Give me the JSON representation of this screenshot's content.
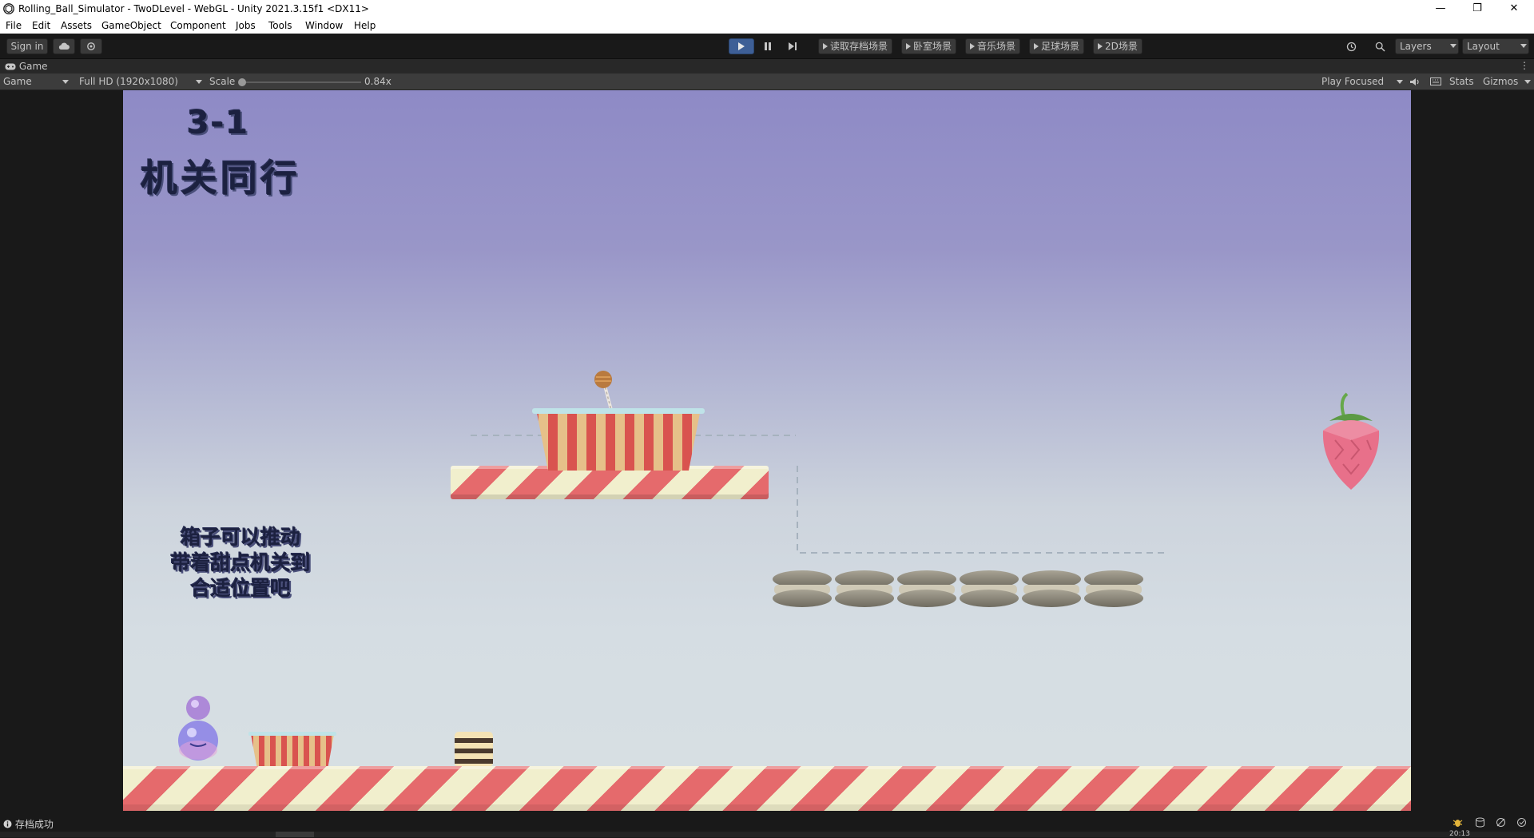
{
  "window": {
    "title": "Rolling_Ball_Simulator - TwoDLevel - WebGL - Unity 2021.3.15f1 <DX11>",
    "minimize": "—",
    "maximize": "❐",
    "close": "✕"
  },
  "menu": [
    "File",
    "Edit",
    "Assets",
    "GameObject",
    "Component",
    "Jobs",
    "Tools",
    "Window",
    "Help"
  ],
  "toolbar": {
    "sign_in": "Sign in",
    "scene_buttons": [
      "读取存档场景",
      "卧室场景",
      "音乐场景",
      "足球场景",
      "2D场景"
    ],
    "layers": "Layers",
    "layout": "Layout"
  },
  "tab": {
    "label": "Game"
  },
  "gamebar": {
    "display": "Game",
    "resolution": "Full HD (1920x1080)",
    "scale_label": "Scale",
    "scale_value": "0.84x",
    "scale_fraction": 0.0,
    "play_mode": "Play Focused",
    "stats": "Stats",
    "gizmos": "Gizmos"
  },
  "level": {
    "number": "3-1",
    "name": "机关同行",
    "hint_lines": [
      "箱子可以推动",
      "带着甜点机关到",
      "合适位置吧"
    ]
  },
  "status": {
    "message": "存档成功",
    "time": "20:13"
  },
  "colors": {
    "play_active": "#3e5f96",
    "stripe_red": "#e56a6c",
    "stripe_cream": "#f1efcd",
    "cup_red": "#d9534f",
    "cup_tan": "#e6c089",
    "strawberry": "#e8708a"
  }
}
